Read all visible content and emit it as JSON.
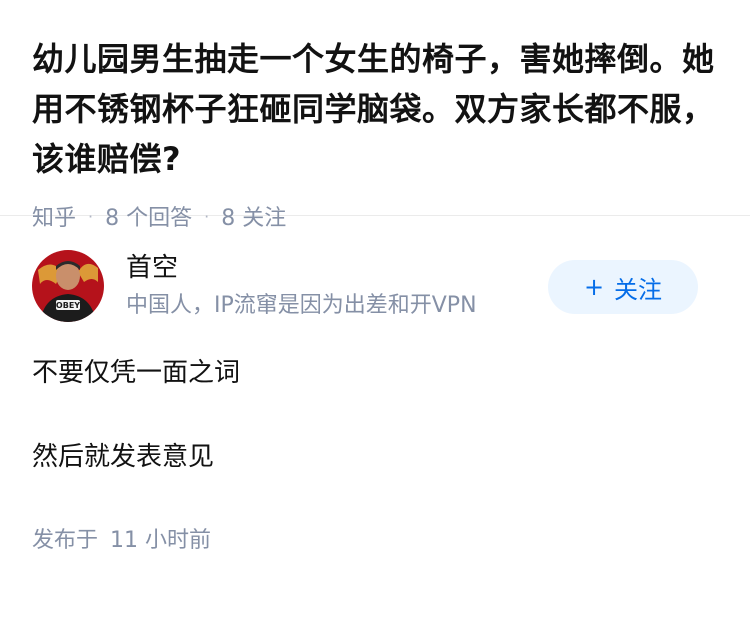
{
  "question": {
    "title": "幼儿园男生抽走一个女生的椅子，害她摔倒。她用不锈钢杯子狂砸同学脑袋。双方家长都不服，该谁赔偿?",
    "source": "知乎",
    "answer_count": "8 个回答",
    "follower_count": "8 关注",
    "separator": "·"
  },
  "answer": {
    "author": {
      "name": "首空",
      "bio": "中国人，IP流窜是因为出差和开VPN",
      "avatar_icon": "avatar-person-icon",
      "avatar_shirt_text": "OBEY"
    },
    "follow_button": {
      "plus": "+",
      "label": "关注"
    },
    "paragraphs": [
      "不要仅凭一面之词",
      "然后就发表意见"
    ],
    "time_prefix": "发布于",
    "time_value": "11 小时前"
  },
  "colors": {
    "title": "#121212",
    "meta": "#8590a6",
    "follow_bg": "#ebf5ff",
    "follow_text": "#056de8",
    "avatar_bg": "#b5121b"
  }
}
